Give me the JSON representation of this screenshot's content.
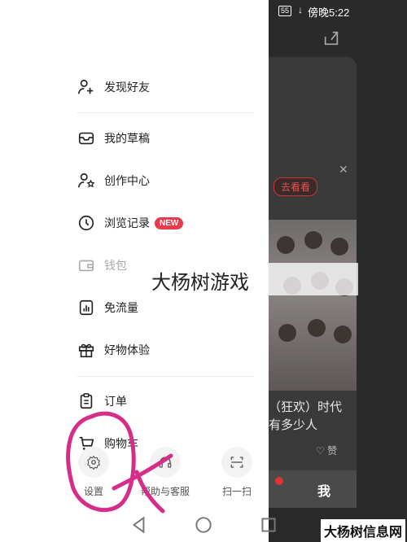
{
  "status_bar": {
    "battery": "55",
    "network": "↓",
    "time": "傍晚5:22"
  },
  "background_app": {
    "go_look_label": "去看看",
    "headline_line1": "（狂欢）时代",
    "headline_line2": "有多少人",
    "like_count": "赞",
    "tab_me": "我",
    "accent_color": "#e8394d"
  },
  "drawer": {
    "items": [
      {
        "label": "发现好友",
        "icon": "add-user-icon"
      },
      {
        "label": "我的草稿",
        "icon": "drafts-tray-icon"
      },
      {
        "label": "创作中心",
        "icon": "creator-center-icon"
      },
      {
        "label": "浏览记录",
        "icon": "history-clock-icon",
        "badge": "NEW"
      },
      {
        "label": "钱包",
        "icon": "wallet-icon"
      },
      {
        "label": "免流量",
        "icon": "free-data-icon"
      },
      {
        "label": "好物体验",
        "icon": "gift-icon"
      },
      {
        "label": "订单",
        "icon": "order-clipboard-icon"
      },
      {
        "label": "购物车",
        "icon": "cart-icon"
      }
    ],
    "bottom_actions": [
      {
        "label": "设置",
        "icon": "gear-icon"
      },
      {
        "label": "帮助与客服",
        "icon": "headset-icon"
      },
      {
        "label": "扫一扫",
        "icon": "scan-icon"
      }
    ]
  },
  "overlay": {
    "watermark": "大杨树游戏",
    "corner_watermark": "大杨树信息网"
  },
  "navbar": {
    "back": "back-triangle-icon",
    "home": "home-circle-icon",
    "recents": "recents-square-icon"
  }
}
